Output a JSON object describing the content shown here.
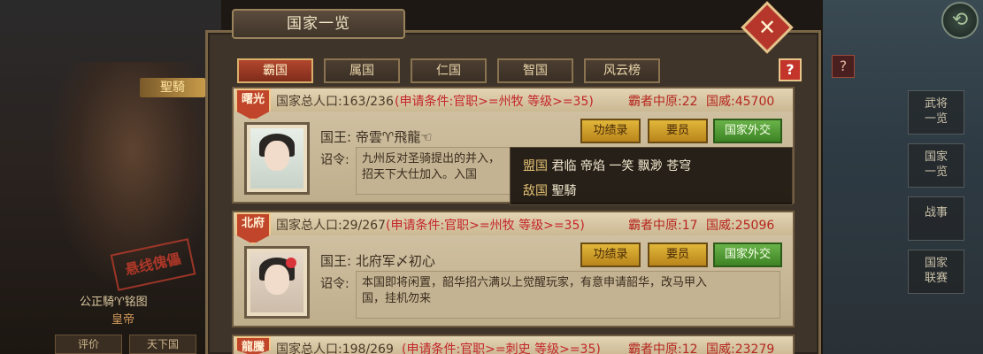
{
  "background": {
    "hero_badge": "聖騎",
    "hero_stamp": "悬线傀儡",
    "hero_name": "公正騎♈铭图",
    "hero_rank": "皇帝",
    "hero_buttons": [
      "评价",
      "天下国"
    ],
    "side_buttons": [
      {
        "label": "武将\n一览"
      },
      {
        "label": "国家\n一览"
      },
      {
        "label": "战事"
      },
      {
        "label": "国家\n联赛"
      }
    ],
    "top_right_icon": "back-arrow-icon",
    "small_help": "?"
  },
  "panel": {
    "title": "国家一览",
    "close_icon": "close-x-icon",
    "help": "?",
    "tabs": [
      {
        "label": "霸国",
        "active": true
      },
      {
        "label": "属国",
        "active": false
      },
      {
        "label": "仁国",
        "active": false
      },
      {
        "label": "智国",
        "active": false
      },
      {
        "label": "风云榜",
        "active": false
      }
    ],
    "cards": [
      {
        "shield": "曙光",
        "population": "国家总人口:163/236",
        "requirement": "(申请条件:官职>=州牧 等级>=35)",
        "hegemony": "霸者中原:22",
        "prestige": "国威:45700",
        "king": "国王: 帝雲♈飛龍☜",
        "edict_label": "诏令:",
        "edict": "九州反对圣骑提出的并入，\n招天下大仕加入。入国",
        "buttons": {
          "merit": "功绩录",
          "officials": "要员",
          "diplomacy": "国家外交"
        }
      },
      {
        "shield": "北府",
        "population": "国家总人口:29/267",
        "requirement": "(申请条件:官职>=州牧 等级>=35)",
        "hegemony": "霸者中原:17",
        "prestige": "国威:25096",
        "king": "国王: 北府军〆初心",
        "edict_label": "诏令:",
        "edict": "本国即将闲置，韶华招六满以上觉醒玩家，有意申请韶华，改马甲入\n国，挂机勿来",
        "buttons": {
          "merit": "功绩录",
          "officials": "要员",
          "diplomacy": "国家外交"
        }
      },
      {
        "shield": "龍騰",
        "population": "国家总人口:198/269",
        "requirement": "(申请条件:官职>=刺史 等级>=35)",
        "hegemony": "霸者中原:12",
        "prestige": "国威:23279"
      }
    ],
    "tooltip": {
      "ally_label": "盟国",
      "ally_value": "君临  帝焰  一笑  飘渺  苍穹",
      "enemy_label": "敌国",
      "enemy_value": "聖騎"
    }
  }
}
